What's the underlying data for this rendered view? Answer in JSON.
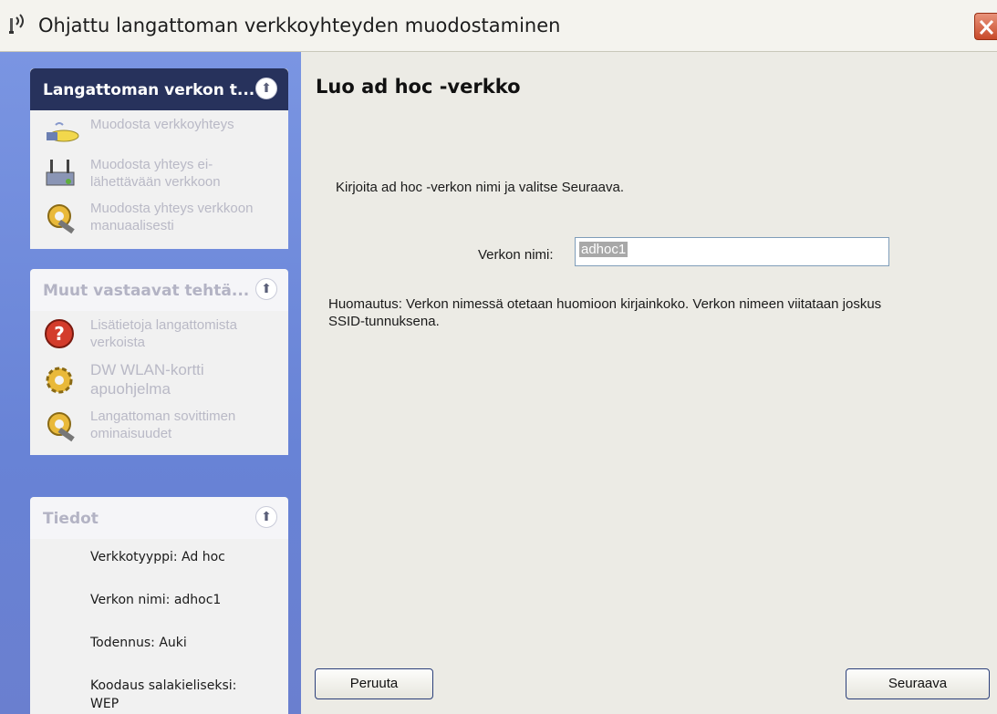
{
  "window": {
    "title": "Ohjattu langattoman verkkoyhteyden muodostaminen",
    "icon": "wireless-antenna-icon",
    "close_icon": "close-icon"
  },
  "sidebar": {
    "network_tasks": {
      "title": "Langattoman verkon t...",
      "items": [
        {
          "label": "Muodosta verkkoyhteys",
          "icon": "network-connect-icon"
        },
        {
          "label": "Muodosta yhteys ei-lähettävään verkkoon",
          "icon": "router-icon"
        },
        {
          "label": "Muodosta yhteys verkkoon manuaalisesti",
          "icon": "gear-wrench-icon"
        }
      ]
    },
    "related_tasks": {
      "title": "Muut vastaavat tehtä...",
      "items": [
        {
          "label": "Lisätietoja langattomista verkoista",
          "icon": "help-icon"
        },
        {
          "label": "DW WLAN-kortti apuohjelma",
          "icon": "gear-icon"
        },
        {
          "label": "Langattoman sovittimen ominaisuudet",
          "icon": "gear-wrench-icon"
        }
      ]
    },
    "details": {
      "title": "Tiedot",
      "rows": [
        "Verkkotyyppi: Ad hoc",
        "Verkon nimi: adhoc1",
        "Todennus: Auki",
        "Koodaus salakieliseksi:",
        "WEP"
      ]
    }
  },
  "main": {
    "heading": "Luo ad hoc -verkko",
    "instruction": "Kirjoita ad hoc -verkon nimi ja valitse Seuraava.",
    "network_name_label": "Verkon nimi:",
    "network_name_value": "adhoc1",
    "note_line1": "Huomautus: Verkon nimessä otetaan huomioon kirjainkoko. Verkon nimeen viitataan joskus",
    "note_line2": "SSID-tunnuksena.",
    "cancel_label": "Peruuta",
    "next_label": "Seuraava"
  },
  "colors": {
    "sidebar": "#6e87d8",
    "header_dark": "#27325c",
    "main_bg": "#ecebe5",
    "close_red": "#d0553a"
  }
}
